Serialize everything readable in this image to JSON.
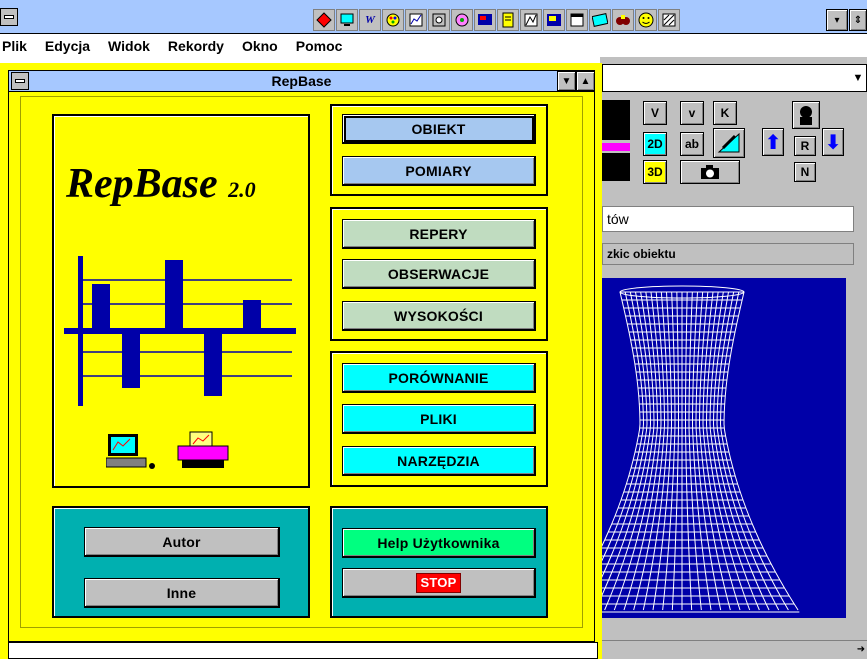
{
  "menu": {
    "items": [
      {
        "label": "Plik"
      },
      {
        "label": "Edycja"
      },
      {
        "label": "Widok"
      },
      {
        "label": "Rekordy"
      },
      {
        "label": "Okno"
      },
      {
        "label": "Pomoc"
      }
    ]
  },
  "toolbar_icons": [
    "diamond-icon",
    "monitor-icon",
    "script-icon",
    "palette-icon",
    "chart-icon",
    "puzzle-icon",
    "paint-icon",
    "flag-icon",
    "book-icon",
    "graph-icon",
    "image-icon",
    "window-icon",
    "card-icon",
    "binoculars-icon",
    "smiley-icon",
    "pattern-icon"
  ],
  "dialog": {
    "title": "RepBase",
    "logo": {
      "name": "RepBase",
      "version": "2.0"
    },
    "groups": {
      "object": {
        "buttons": [
          "OBIEKT",
          "POMIARY"
        ]
      },
      "data": {
        "buttons": [
          "REPERY",
          "OBSERWACJE",
          "WYSOKOŚCI"
        ]
      },
      "tools": {
        "buttons": [
          "PORÓWNANIE",
          "PLIKI",
          "NARZĘDZIA"
        ]
      },
      "bottom_left": {
        "buttons": [
          "Autor",
          "Inne"
        ]
      },
      "bottom_right": {
        "help": "Help Użytkownika",
        "stop": "STOP"
      }
    }
  },
  "bg_window": {
    "text_field": "tów",
    "sketch_header": "zkic obiektu",
    "tool_buttons": {
      "v_upper": "V",
      "v_lower": "v",
      "k": "K",
      "two_d": "2D",
      "ab": "ab",
      "three_d": "3D",
      "r": "R",
      "n": "N"
    }
  },
  "colors": {
    "app_title": "#a6c8ff",
    "dialog_bg": "#ffff00",
    "panel_teal": "#00b0b0",
    "button_blue": "#a6c8f0",
    "button_green": "#c0dcc0",
    "button_cyan": "#00ffff",
    "sketch_bg": "#0000a8",
    "chart_bar": "#0000a8"
  }
}
